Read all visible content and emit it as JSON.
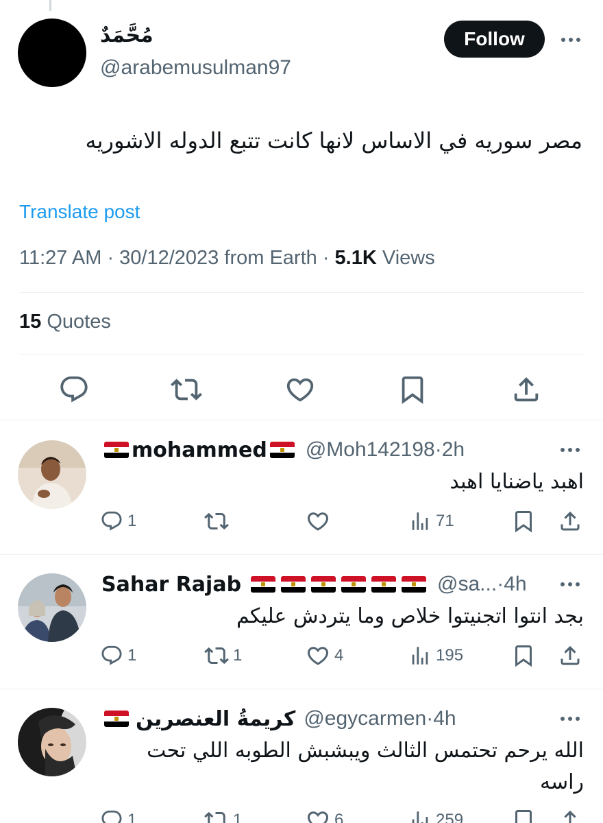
{
  "post": {
    "author_name": "مُحَّمَدٌ",
    "author_handle": "@arabemusulman97",
    "follow_label": "Follow",
    "text": "مصر سوريه في الاساس لانها كانت تتبع الدوله الاشوريه",
    "translate_label": "Translate post",
    "time": "11:27 AM",
    "date": "30/12/2023",
    "source": "from Earth",
    "views_count": "5.1K",
    "views_label": "Views",
    "quotes_count": "15",
    "quotes_label": "Quotes"
  },
  "replies": [
    {
      "name": "mohammed",
      "handle": "@Moh142198",
      "time": "2h",
      "text": "اهبد ياضنايا اهبد",
      "replies": "1",
      "reposts": "",
      "likes": "",
      "views": "71"
    },
    {
      "name": "Sahar Rajab",
      "handle": "@sa...",
      "time": "4h",
      "text": "بجد انتوا اتجنيتوا خلاص وما يتردش عليكم",
      "replies": "1",
      "reposts": "1",
      "likes": "4",
      "views": "195"
    },
    {
      "name": "كريمةُ العنصرين",
      "handle": "@egycarmen",
      "time": "4h",
      "text": "الله يرحم تحتمس الثالث ويبشبش الطوبه اللي تحت راسه",
      "replies": "1",
      "reposts": "1",
      "likes": "6",
      "views": "259"
    }
  ],
  "icons": {
    "reply": "speech-bubble-icon",
    "repost": "repost-arrows-icon",
    "like": "heart-icon",
    "bookmark": "bookmark-icon",
    "share": "share-upload-icon",
    "views": "bar-chart-icon",
    "more": "more-dots-icon",
    "flag": "egypt-flag-icon"
  },
  "colors": {
    "link": "#1d9bf0",
    "secondary_text": "#536471",
    "follow_bg": "#0f1419",
    "divider": "#eff3f4"
  }
}
